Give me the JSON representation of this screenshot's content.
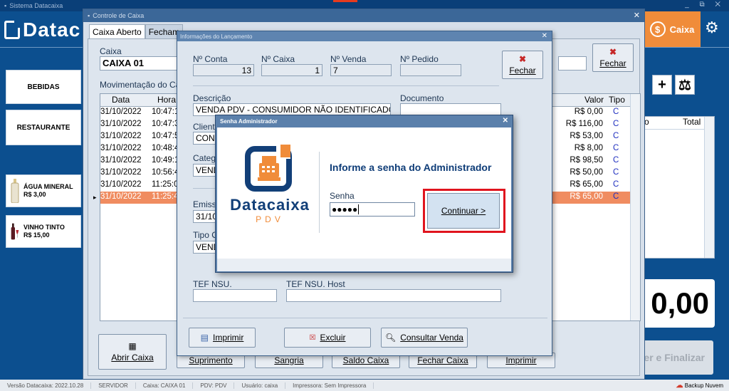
{
  "main": {
    "window_title": "Sistema Datacaixa",
    "window_controls": "_ ⧉ ✕",
    "logo": "Datac",
    "caixa_button": "Caixa",
    "caixa_icon_glyph": "$",
    "gear_glyph": "⚙"
  },
  "sidebar": {
    "categories": [
      "BEBIDAS",
      "RESTAURANTE"
    ],
    "products": [
      {
        "name": "ÁGUA MINERAL",
        "price": "R$ 3,00"
      },
      {
        "name": "VINHO TINTO",
        "price": "R$ 15,00"
      }
    ]
  },
  "right": {
    "headers": [
      "o",
      "Total"
    ],
    "plus": "+",
    "scale_glyph": "⚖",
    "total": "0,00",
    "finalizar": "er e Finalizar"
  },
  "statusbar": {
    "items": [
      "Versão Datacaixa: 2022.10.28",
      "SERVIDOR",
      "Caixa: CAIXA 01",
      "PDV: PDV",
      "Usuário: caixa",
      "Impressora: Sem Impressora"
    ],
    "backup": "Backup Nuvem"
  },
  "controle": {
    "title": "Controle de Caixa",
    "close": "✕",
    "tabs": [
      "Caixa Aberto",
      "Fecham"
    ],
    "caixa_label": "Caixa",
    "caixa_value": "CAIXA 01",
    "mov_label": "Movimentação do Ca",
    "fechar": "Fechar",
    "grid_headers": {
      "data": "Data",
      "hora": "Hora",
      "valor": "Valor",
      "tipo": "Tipo"
    },
    "rows": [
      {
        "data": "31/10/2022",
        "hora": "10:47:1",
        "valor": "R$ 0,00",
        "tipo": "C"
      },
      {
        "data": "31/10/2022",
        "hora": "10:47:3",
        "valor": "R$ 116,00",
        "tipo": "C"
      },
      {
        "data": "31/10/2022",
        "hora": "10:47:5",
        "valor": "R$ 53,00",
        "tipo": "C"
      },
      {
        "data": "31/10/2022",
        "hora": "10:48:4",
        "valor": "R$ 8,00",
        "tipo": "C"
      },
      {
        "data": "31/10/2022",
        "hora": "10:49:1",
        "valor": "R$ 98,50",
        "tipo": "C"
      },
      {
        "data": "31/10/2022",
        "hora": "10:56:4",
        "valor": "R$ 50,00",
        "tipo": "C"
      },
      {
        "data": "31/10/2022",
        "hora": "11:25:0",
        "valor": "R$ 65,00",
        "tipo": "C"
      },
      {
        "data": "31/10/2022",
        "hora": "11:25:4",
        "valor": "R$ 65,00",
        "tipo": "C"
      }
    ],
    "row_pointer": "▸",
    "bottom_buttons": [
      "Abrir Caixa",
      "Suprimento",
      "Sangria",
      "Saldo Caixa",
      "Fechar Caixa",
      "Imprimir"
    ]
  },
  "lancamento": {
    "title": "Informações do Lançamento",
    "close": "✕",
    "no_conta_label": "Nº Conta",
    "no_conta": "13",
    "no_caixa_label": "Nº Caixa",
    "no_caixa": "1",
    "no_venda_label": "Nº Venda",
    "no_venda": "7",
    "no_pedido_label": "Nº Pedido",
    "no_pedido": "",
    "fechar": "Fechar",
    "descricao_label": "Descrição",
    "descricao": "VENDA PDV - CONSUMIDOR NÃO IDENTIFICADO",
    "documento_label": "Documento",
    "cliente_label": "Cliente",
    "cliente": "CONS",
    "categoria_label": "Catego",
    "categoria": "VENDA",
    "emissao_label": "Emissã",
    "emissao": "31/10",
    "tipo_label": "Tipo O",
    "tipo": "VENDA",
    "tef_nsu_label": "TEF NSU.",
    "tef_host_label": "TEF NSU. Host",
    "imprimir": "Imprimir",
    "excluir": "Excluir",
    "consultar": "Consultar Venda"
  },
  "senha": {
    "title": "Senha Administrador",
    "close": "✕",
    "brand": "Datacaixa",
    "brand_sub": "PDV",
    "heading": "Informe a senha do Administrador",
    "label": "Senha",
    "masked_value": "●●●●●",
    "continuar": "Continuar >"
  },
  "colors": {
    "background": "#0c4f8f",
    "accent_orange": "#f08c3a",
    "selected_row": "#f08c60",
    "highlight_red": "#e0141e"
  }
}
